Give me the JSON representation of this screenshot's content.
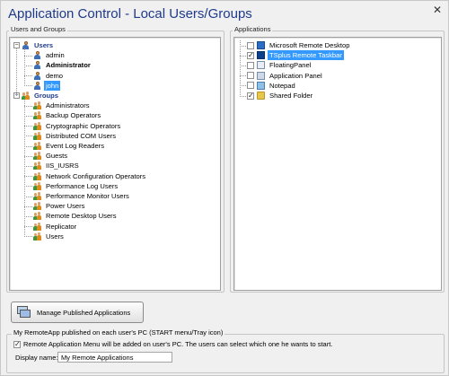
{
  "window": {
    "title": "Application Control - Local Users/Groups"
  },
  "users_groups": {
    "label": "Users and Groups",
    "users_header": "Users",
    "users": [
      {
        "name": "admin",
        "bold": false,
        "selected": false
      },
      {
        "name": "Administrator",
        "bold": true,
        "selected": false
      },
      {
        "name": "demo",
        "bold": false,
        "selected": false
      },
      {
        "name": "john",
        "bold": false,
        "selected": true
      }
    ],
    "groups_header": "Groups",
    "groups": [
      "Administrators",
      "Backup Operators",
      "Cryptographic Operators",
      "Distributed COM Users",
      "Event Log Readers",
      "Guests",
      "IIS_IUSRS",
      "Network Configuration Operators",
      "Performance Log Users",
      "Performance Monitor Users",
      "Power Users",
      "Remote Desktop Users",
      "Replicator",
      "Users"
    ]
  },
  "applications": {
    "label": "Applications",
    "items": [
      {
        "name": "Microsoft Remote Desktop",
        "checked": false,
        "selected": false,
        "icon": "remote-desktop-icon"
      },
      {
        "name": "TSplus Remote Taskbar",
        "checked": true,
        "selected": true,
        "icon": "taskbar-icon"
      },
      {
        "name": "FloatingPanel",
        "checked": false,
        "selected": false,
        "icon": "floating-panel-icon"
      },
      {
        "name": "Application Panel",
        "checked": false,
        "selected": false,
        "icon": "application-panel-icon"
      },
      {
        "name": "Notepad",
        "checked": false,
        "selected": false,
        "icon": "notepad-icon"
      },
      {
        "name": "Shared Folder",
        "checked": true,
        "selected": false,
        "icon": "folder-icon"
      }
    ]
  },
  "manage_button": {
    "label": "Manage Published Applications"
  },
  "remoteapp": {
    "label": "My RemoteApp published on each user's PC (START menu/Tray icon)",
    "checkbox_label": "Remote Application Menu will be added on user's PC. The users can select which one he wants to start.",
    "checked": true,
    "display_name_label": "Display name:",
    "display_name_value": "My Remote Applications"
  },
  "colors": {
    "title": "#1e3a8a",
    "selection": "#3399ff"
  }
}
